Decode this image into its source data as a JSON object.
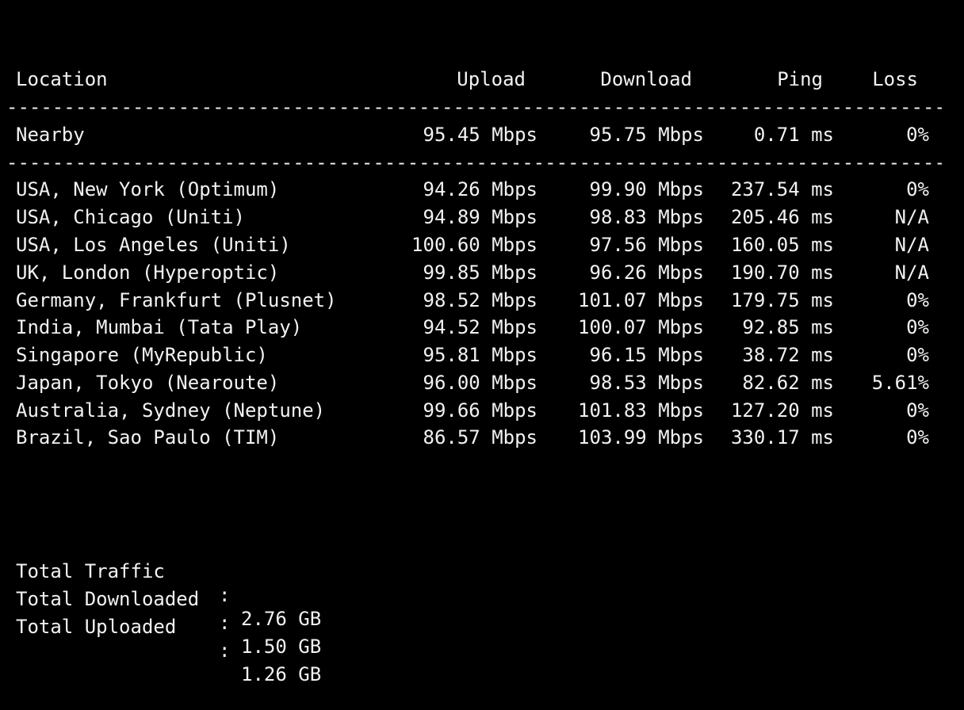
{
  "header": {
    "location": "Location",
    "upload": "Upload",
    "download": "Download",
    "ping": "Ping",
    "loss": "Loss"
  },
  "divider_text": "----------------------------------------------------------------------------------------------------",
  "nearby": {
    "location": "Nearby",
    "upload": "95.45 Mbps",
    "download": "95.75 Mbps",
    "ping": "0.71 ms",
    "loss": "0%"
  },
  "rows": [
    {
      "location": "USA, New York (Optimum)",
      "upload": "94.26 Mbps",
      "download": "99.90 Mbps",
      "ping": "237.54 ms",
      "loss": "0%"
    },
    {
      "location": "USA, Chicago (Uniti)",
      "upload": "94.89 Mbps",
      "download": "98.83 Mbps",
      "ping": "205.46 ms",
      "loss": "N/A"
    },
    {
      "location": "USA, Los Angeles (Uniti)",
      "upload": "100.60 Mbps",
      "download": "97.56 Mbps",
      "ping": "160.05 ms",
      "loss": "N/A"
    },
    {
      "location": "UK, London (Hyperoptic)",
      "upload": "99.85 Mbps",
      "download": "96.26 Mbps",
      "ping": "190.70 ms",
      "loss": "N/A"
    },
    {
      "location": "Germany, Frankfurt (Plusnet)",
      "upload": "98.52 Mbps",
      "download": "101.07 Mbps",
      "ping": "179.75 ms",
      "loss": "0%"
    },
    {
      "location": "India, Mumbai (Tata Play)",
      "upload": "94.52 Mbps",
      "download": "100.07 Mbps",
      "ping": "92.85 ms",
      "loss": "0%"
    },
    {
      "location": "Singapore (MyRepublic)",
      "upload": "95.81 Mbps",
      "download": "96.15 Mbps",
      "ping": "38.72 ms",
      "loss": "0%"
    },
    {
      "location": "Japan, Tokyo (Nearoute)",
      "upload": "96.00 Mbps",
      "download": "98.53 Mbps",
      "ping": "82.62 ms",
      "loss": "5.61%"
    },
    {
      "location": "Australia, Sydney (Neptune)",
      "upload": "99.66 Mbps",
      "download": "101.83 Mbps",
      "ping": "127.20 ms",
      "loss": "0%"
    },
    {
      "location": "Brazil, Sao Paulo (TIM)",
      "upload": "86.57 Mbps",
      "download": "103.99 Mbps",
      "ping": "330.17 ms",
      "loss": "0%"
    }
  ],
  "summary": {
    "separator": ":",
    "total_traffic_label": "Total Traffic",
    "total_traffic_value": "2.76 GB",
    "total_downloaded_label": "Total Downloaded",
    "total_downloaded_value": "1.50 GB",
    "total_uploaded_label": "Total Uploaded",
    "total_uploaded_value": "1.26 GB"
  },
  "colors": {
    "background": "#000000",
    "text": "#f2f2f2"
  }
}
